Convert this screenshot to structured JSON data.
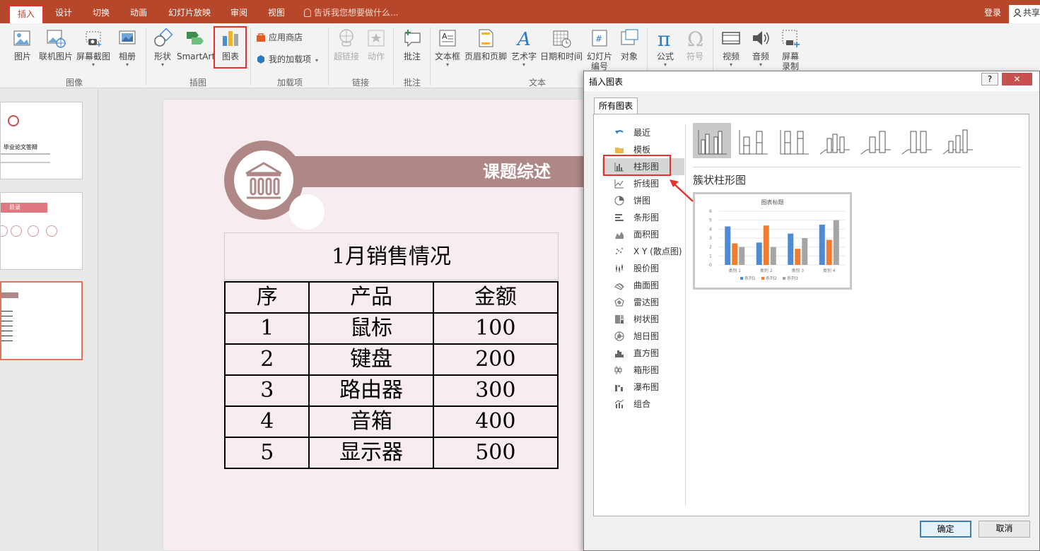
{
  "menu": {
    "tabs": [
      {
        "label": "插入",
        "active": true
      },
      {
        "label": "设计"
      },
      {
        "label": "切换"
      },
      {
        "label": "动画"
      },
      {
        "label": "幻灯片放映"
      },
      {
        "label": "审阅"
      },
      {
        "label": "视图"
      }
    ],
    "tell_me": "告诉我您想要做什么...",
    "login": "登录",
    "share": "共享"
  },
  "ribbon": {
    "buttons": {
      "picture": "图片",
      "online_picture": "联机图片",
      "screenshot": "屏幕截图",
      "album": "相册",
      "shapes": "形状",
      "smartart": "SmartArt",
      "chart": "图表",
      "store": "应用商店",
      "my_addins": "我的加载项",
      "hyperlink": "超链接",
      "action": "动作",
      "comment": "批注",
      "textbox": "文本框",
      "header_footer": "页眉和页脚",
      "wordart": "艺术字",
      "date_time": "日期和时间",
      "slide_number_1": "幻灯片",
      "slide_number_2": "编号",
      "object": "对象",
      "equation": "公式",
      "symbol": "符号",
      "video": "视频",
      "audio": "音频",
      "screen_recording_1": "屏幕",
      "screen_recording_2": "录制"
    },
    "groups": {
      "images": "图像",
      "illustrations": "插图",
      "addins": "加载项",
      "links": "链接",
      "comments": "批注",
      "text": "文本"
    }
  },
  "slide": {
    "banner_title": "课题综述",
    "table_title": "1月销售情况",
    "headers": [
      "序",
      "产品",
      "金额"
    ],
    "rows": [
      [
        "1",
        "鼠标",
        "100"
      ],
      [
        "2",
        "键盘",
        "200"
      ],
      [
        "3",
        "路由器",
        "300"
      ],
      [
        "4",
        "音箱",
        "400"
      ],
      [
        "5",
        "显示器",
        "500"
      ]
    ]
  },
  "thumbnails": {
    "slide1_title": "毕业论文答辩",
    "slide2_title": "目录"
  },
  "dialog": {
    "title": "插入图表",
    "help": "?",
    "close": "✕",
    "tab": "所有图表",
    "chart_types": [
      {
        "label": "最近",
        "icon": "undo-icon"
      },
      {
        "label": "模板",
        "icon": "folder-icon"
      },
      {
        "label": "柱形图",
        "icon": "column-chart-icon",
        "selected": true
      },
      {
        "label": "折线图",
        "icon": "line-chart-icon"
      },
      {
        "label": "饼图",
        "icon": "pie-chart-icon"
      },
      {
        "label": "条形图",
        "icon": "bar-chart-icon"
      },
      {
        "label": "面积图",
        "icon": "area-chart-icon"
      },
      {
        "label": "X Y (散点图)",
        "icon": "scatter-chart-icon"
      },
      {
        "label": "股价图",
        "icon": "stock-chart-icon"
      },
      {
        "label": "曲面图",
        "icon": "surface-chart-icon"
      },
      {
        "label": "雷达图",
        "icon": "radar-chart-icon"
      },
      {
        "label": "树状图",
        "icon": "treemap-chart-icon"
      },
      {
        "label": "旭日图",
        "icon": "sunburst-chart-icon"
      },
      {
        "label": "直方图",
        "icon": "histogram-chart-icon"
      },
      {
        "label": "箱形图",
        "icon": "boxplot-chart-icon"
      },
      {
        "label": "瀑布图",
        "icon": "waterfall-chart-icon"
      },
      {
        "label": "组合",
        "icon": "combo-chart-icon"
      }
    ],
    "subtype_name": "簇状柱形图",
    "ok": "确定",
    "cancel": "取消"
  },
  "chart_data": {
    "type": "bar",
    "title": "图表标题",
    "categories": [
      "类别 1",
      "类别 2",
      "类别 3",
      "类别 4"
    ],
    "series": [
      {
        "name": "系列1",
        "values": [
          4.3,
          2.5,
          3.5,
          4.5
        ],
        "color": "#4e8ad6"
      },
      {
        "name": "系列2",
        "values": [
          2.4,
          4.4,
          1.8,
          2.8
        ],
        "color": "#ee7d31"
      },
      {
        "name": "系列3",
        "values": [
          2.0,
          2.0,
          3.0,
          5.0
        ],
        "color": "#a5a5a5"
      }
    ],
    "ylim": [
      0,
      6
    ],
    "yticks": [
      "0",
      "1",
      "2",
      "3",
      "4",
      "5",
      "6"
    ],
    "grid": true,
    "legend": "bottom"
  },
  "colors": {
    "accent": "#b7472a",
    "highlight": "#e5322d",
    "banner": "#ae8786",
    "slide_bg": "#f7ecef"
  }
}
